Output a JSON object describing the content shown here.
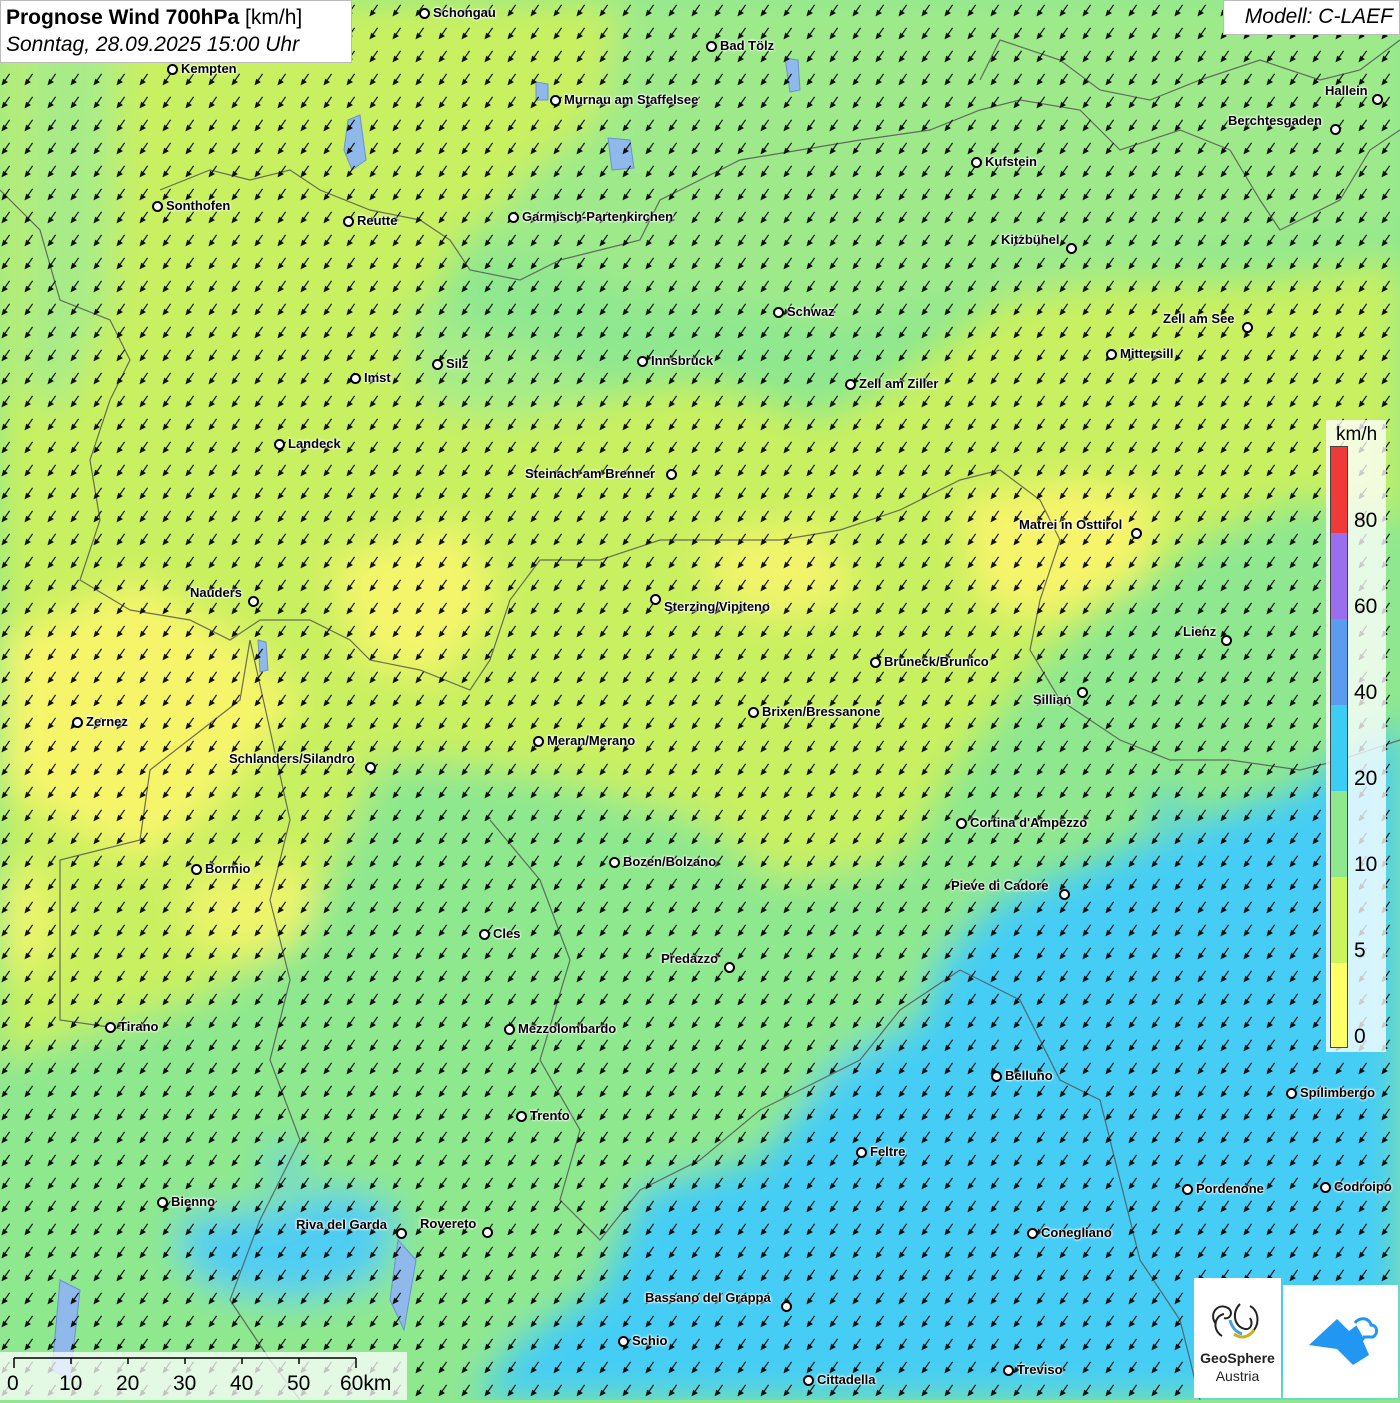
{
  "title": {
    "variable": "Prognose Wind 700hPa",
    "unit": "[km/h]",
    "datetime": "Sonntag, 28.09.2025 15:00 Uhr"
  },
  "model": "Modell: C-LAEF",
  "legend": {
    "unit": "km/h",
    "ticks": [
      "0",
      "5",
      "10",
      "20",
      "40",
      "60",
      "80"
    ],
    "colors": [
      "#ffff66",
      "#ccf55c",
      "#8ee88e",
      "#3ccdf5",
      "#5b9bf0",
      "#9b6ef0",
      "#f03a3a"
    ]
  },
  "scale": {
    "labels": [
      "0",
      "10",
      "20",
      "30",
      "40",
      "50",
      "60km"
    ]
  },
  "wind_direction": "north-east (arrows point south-west)",
  "cities": [
    {
      "name": "Schongau"
    },
    {
      "name": "Bad Tölz"
    },
    {
      "name": "Kempten"
    },
    {
      "name": "Murnau am Staffelsee"
    },
    {
      "name": "Hallein"
    },
    {
      "name": "Berchtesgaden"
    },
    {
      "name": "Kufstein"
    },
    {
      "name": "Sonthofen"
    },
    {
      "name": "Reutte"
    },
    {
      "name": "Garmisch-Partenkirchen"
    },
    {
      "name": "Kitzbühel"
    },
    {
      "name": "Schwaz"
    },
    {
      "name": "Zell am See"
    },
    {
      "name": "Innsbruck"
    },
    {
      "name": "Mittersill"
    },
    {
      "name": "Silz"
    },
    {
      "name": "Imst"
    },
    {
      "name": "Zell am Ziller"
    },
    {
      "name": "Landeck"
    },
    {
      "name": "Steinach am Brenner"
    },
    {
      "name": "Matrei in Osttirol"
    },
    {
      "name": "Nauders"
    },
    {
      "name": "Sterzing/Vipiteno"
    },
    {
      "name": "Lienz"
    },
    {
      "name": "Bruneck/Brunico"
    },
    {
      "name": "Sillian"
    },
    {
      "name": "Brixen/Bressanone"
    },
    {
      "name": "Zernez"
    },
    {
      "name": "Meran/Merano"
    },
    {
      "name": "Schlanders/Silandro"
    },
    {
      "name": "Cortina d'Ampezzo"
    },
    {
      "name": "Bozen/Bolzano"
    },
    {
      "name": "Bormio"
    },
    {
      "name": "Pieve di Cadore"
    },
    {
      "name": "Cles"
    },
    {
      "name": "Predazzo"
    },
    {
      "name": "Tirano"
    },
    {
      "name": "Mezzolombardo"
    },
    {
      "name": "Belluno"
    },
    {
      "name": "Spilimbergo"
    },
    {
      "name": "Trento"
    },
    {
      "name": "Feltre"
    },
    {
      "name": "Pordenone"
    },
    {
      "name": "Codroipo"
    },
    {
      "name": "Bienno"
    },
    {
      "name": "Riva del Garda"
    },
    {
      "name": "Rovereto"
    },
    {
      "name": "Conegliano"
    },
    {
      "name": "Bassano del Grappa"
    },
    {
      "name": "Schio"
    },
    {
      "name": "Treviso"
    },
    {
      "name": "Cittadella"
    }
  ],
  "logos": {
    "geosphere_line1": "GeoSphere",
    "geosphere_line2": "Austria"
  }
}
